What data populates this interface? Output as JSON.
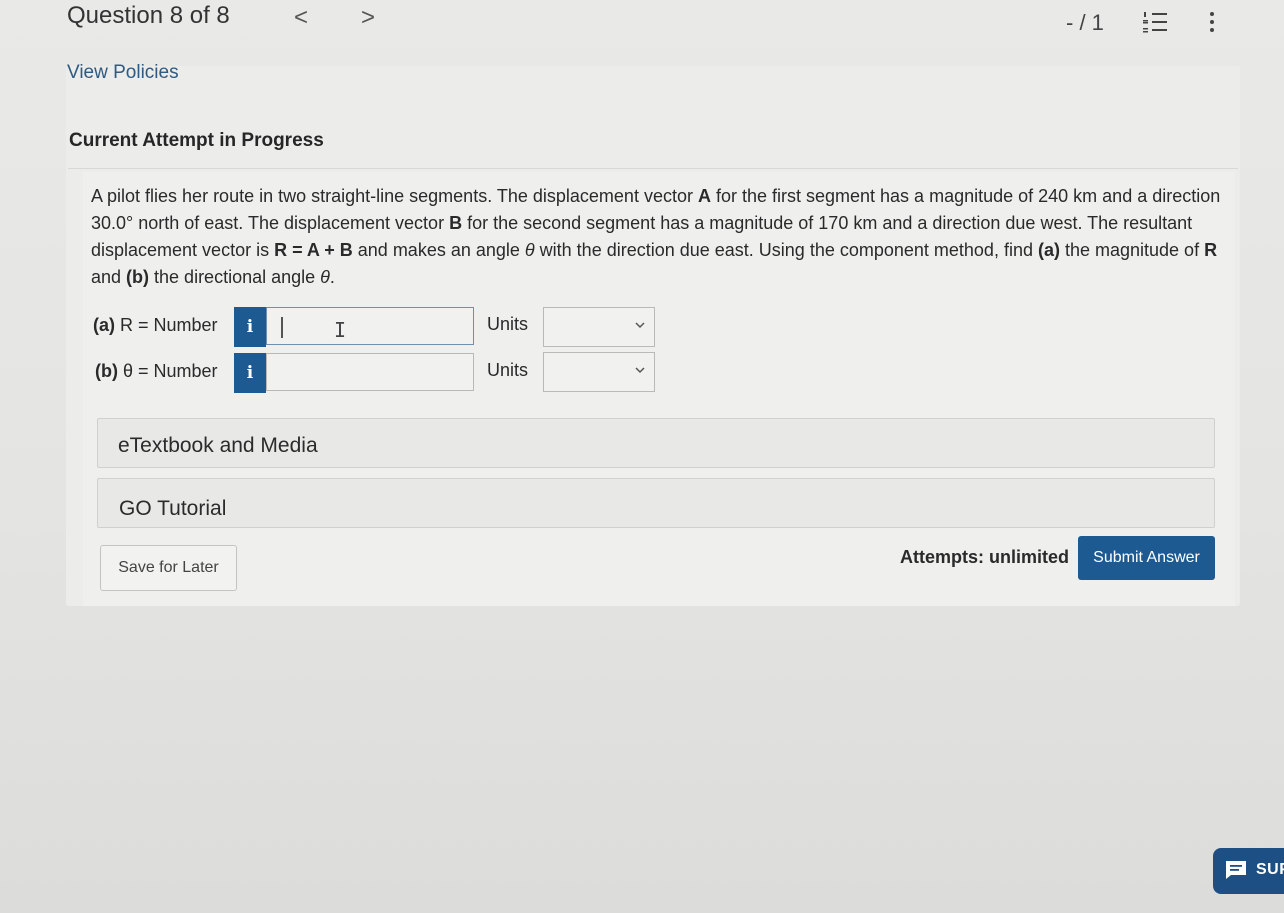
{
  "header": {
    "question_title": "Question 8 of 8",
    "prev_arrow": "<",
    "next_arrow": ">",
    "score": "- / 1",
    "icons": {
      "list": "question-list-icon",
      "more": "more-vertical-icon"
    }
  },
  "view_policies": "View Policies",
  "attempt_heading": "Current Attempt in Progress",
  "question": {
    "t1": "A pilot flies her route in two straight-line segments. The displacement vector ",
    "A": "A",
    "t2": " for the first segment has a magnitude of 240 km and a direction 30.0° north of east. The displacement vector ",
    "B": "B",
    "t3": " for the second segment has a magnitude of 170 km and a direction due west. The resultant displacement vector is ",
    "eq": "R = A + B",
    "t4": " and makes an angle ",
    "theta": "θ",
    "t5": " with the direction due east. Using the component method, find ",
    "pa": "(a)",
    "t6": " the magnitude of ",
    "R": "R",
    "t7": " and ",
    "pb": "(b)",
    "t8": " the directional angle ",
    "theta2": "θ",
    "t9": "."
  },
  "parts": [
    {
      "prefix": "(a)",
      "label": " R = Number",
      "info": "i",
      "value": "",
      "units_label": "Units",
      "units_selected": ""
    },
    {
      "prefix": "(b)",
      "label": " θ = Number",
      "info": "i",
      "value": "",
      "units_label": "Units",
      "units_selected": ""
    }
  ],
  "accordions": {
    "etextbook": "eTextbook and Media",
    "go_tutorial": "GO Tutorial"
  },
  "footer": {
    "save_label": "Save for Later",
    "attempts": "Attempts: unlimited",
    "submit_label": "Submit Answer"
  },
  "support": {
    "label": "SUP",
    "icon": "chat-icon"
  },
  "colors": {
    "accent": "#1e5a92",
    "link": "#2f5a82",
    "support": "#1e4f84"
  }
}
